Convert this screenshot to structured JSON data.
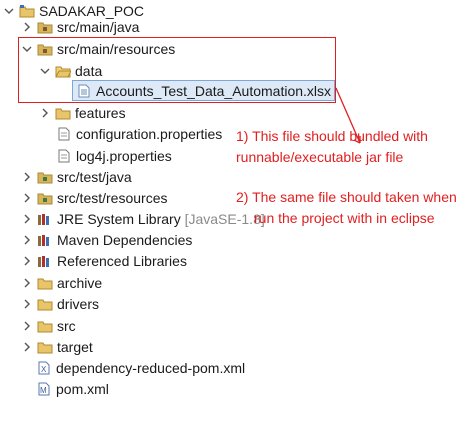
{
  "tree": {
    "root": "SADAKAR_POC",
    "src_main_java": "src/main/java",
    "src_main_resources": "src/main/resources",
    "data_folder": "data",
    "data_file": "Accounts_Test_Data_Automation.xlsx",
    "features": "features",
    "configuration": "configuration.properties",
    "log4j": "log4j.properties",
    "src_test_java": "src/test/java",
    "src_test_resources": "src/test/resources",
    "jre_label": "JRE System Library",
    "jre_version": "[JavaSE-1.8]",
    "maven": "Maven Dependencies",
    "referenced": "Referenced Libraries",
    "archive": "archive",
    "drivers": "drivers",
    "src": "src",
    "target": "target",
    "reduced_pom": "dependency-reduced-pom.xml",
    "pom": "pom.xml"
  },
  "annotations": {
    "note1_line1": "1) This file should bundled with",
    "note1_line2": "runnable/executable jar file",
    "note2_line1": "2) The same file should taken when",
    "note2_line2": "run the project with in eclipse"
  },
  "colors": {
    "annotation": "#e02020",
    "selection": "#dde9f7",
    "folder": "#e8c56a"
  },
  "icons": [
    "project-icon",
    "package-folder-icon",
    "folder-icon",
    "excel-file-icon",
    "properties-file-icon",
    "library-icon",
    "xml-file-icon",
    "pom-file-icon"
  ]
}
